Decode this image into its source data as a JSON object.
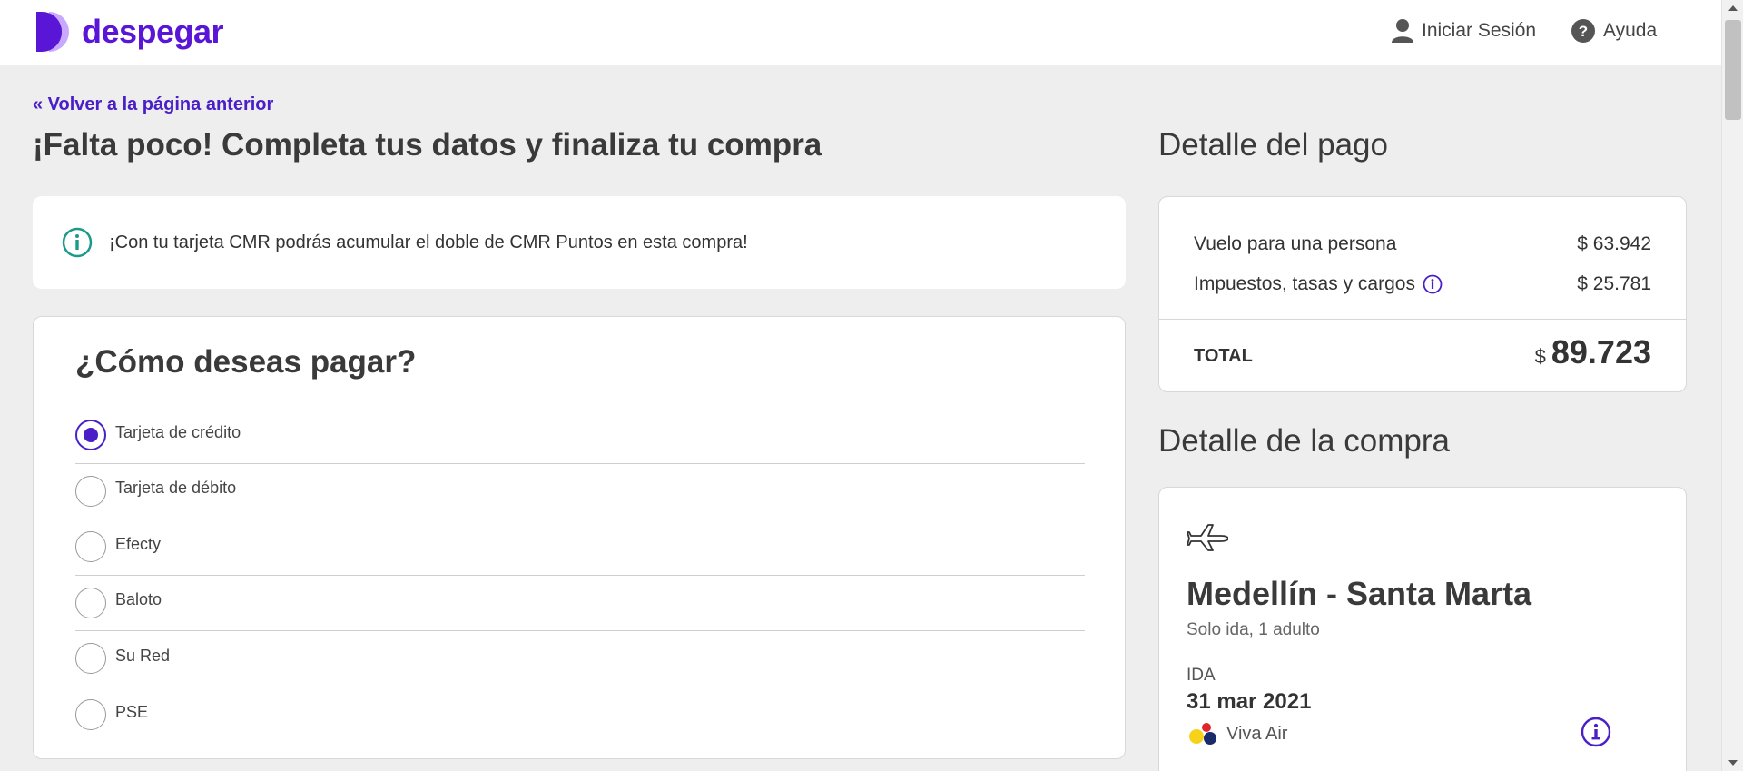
{
  "header": {
    "brand": "despegar",
    "login_label": "Iniciar Sesión",
    "help_label": "Ayuda"
  },
  "back_link": "« Volver a la página anterior",
  "page_title": "¡Falta poco! Completa tus datos y finaliza tu compra",
  "info_banner": "¡Con tu tarjeta CMR podrás acumular el doble de CMR Puntos en esta compra!",
  "payment": {
    "title": "¿Cómo deseas pagar?",
    "options": [
      {
        "label": "Tarjeta de crédito",
        "selected": true
      },
      {
        "label": "Tarjeta de débito",
        "selected": false
      },
      {
        "label": "Efecty",
        "selected": false
      },
      {
        "label": "Baloto",
        "selected": false
      },
      {
        "label": "Su Red",
        "selected": false
      },
      {
        "label": "PSE",
        "selected": false
      }
    ]
  },
  "payment_detail": {
    "title": "Detalle del pago",
    "flight_label": "Vuelo para una persona",
    "flight_value": "$ 63.942",
    "taxes_label": "Impuestos, tasas y cargos",
    "taxes_value": "$ 25.781",
    "total_label": "TOTAL",
    "total_currency": "$",
    "total_value": "89.723"
  },
  "purchase_detail": {
    "title": "Detalle de la compra",
    "route": "Medellín - Santa Marta",
    "subinfo": "Solo ida, 1 adulto",
    "leg_label": "IDA",
    "leg_date": "31 mar 2021",
    "airline": "Viva Air"
  },
  "colors": {
    "brand": "#5a16d6",
    "accent": "#4a1fc7",
    "info_teal": "#1a9a8a",
    "background": "#eeeeee"
  }
}
